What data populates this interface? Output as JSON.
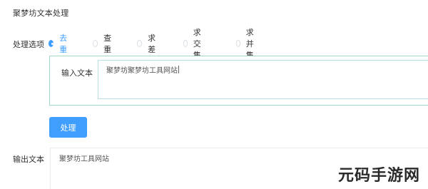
{
  "app": {
    "title": "聚梦坊文本处理"
  },
  "options": {
    "label": "处理选项",
    "items": [
      {
        "label": "去重",
        "checked": true
      },
      {
        "label": "查重",
        "checked": false
      },
      {
        "label": "求差",
        "checked": false
      },
      {
        "label": "求交集",
        "checked": false
      },
      {
        "label": "求并集",
        "checked": false
      }
    ]
  },
  "input": {
    "label": "输入文本",
    "value": "聚梦坊聚梦坊工具网站"
  },
  "process_button": {
    "label": "处理"
  },
  "output": {
    "label": "输出文本",
    "value": "聚梦坊工具网站"
  },
  "watermark": {
    "text": "元码手游网"
  },
  "colors": {
    "accent": "#409eff",
    "panel_border": "#a6d8c6"
  }
}
